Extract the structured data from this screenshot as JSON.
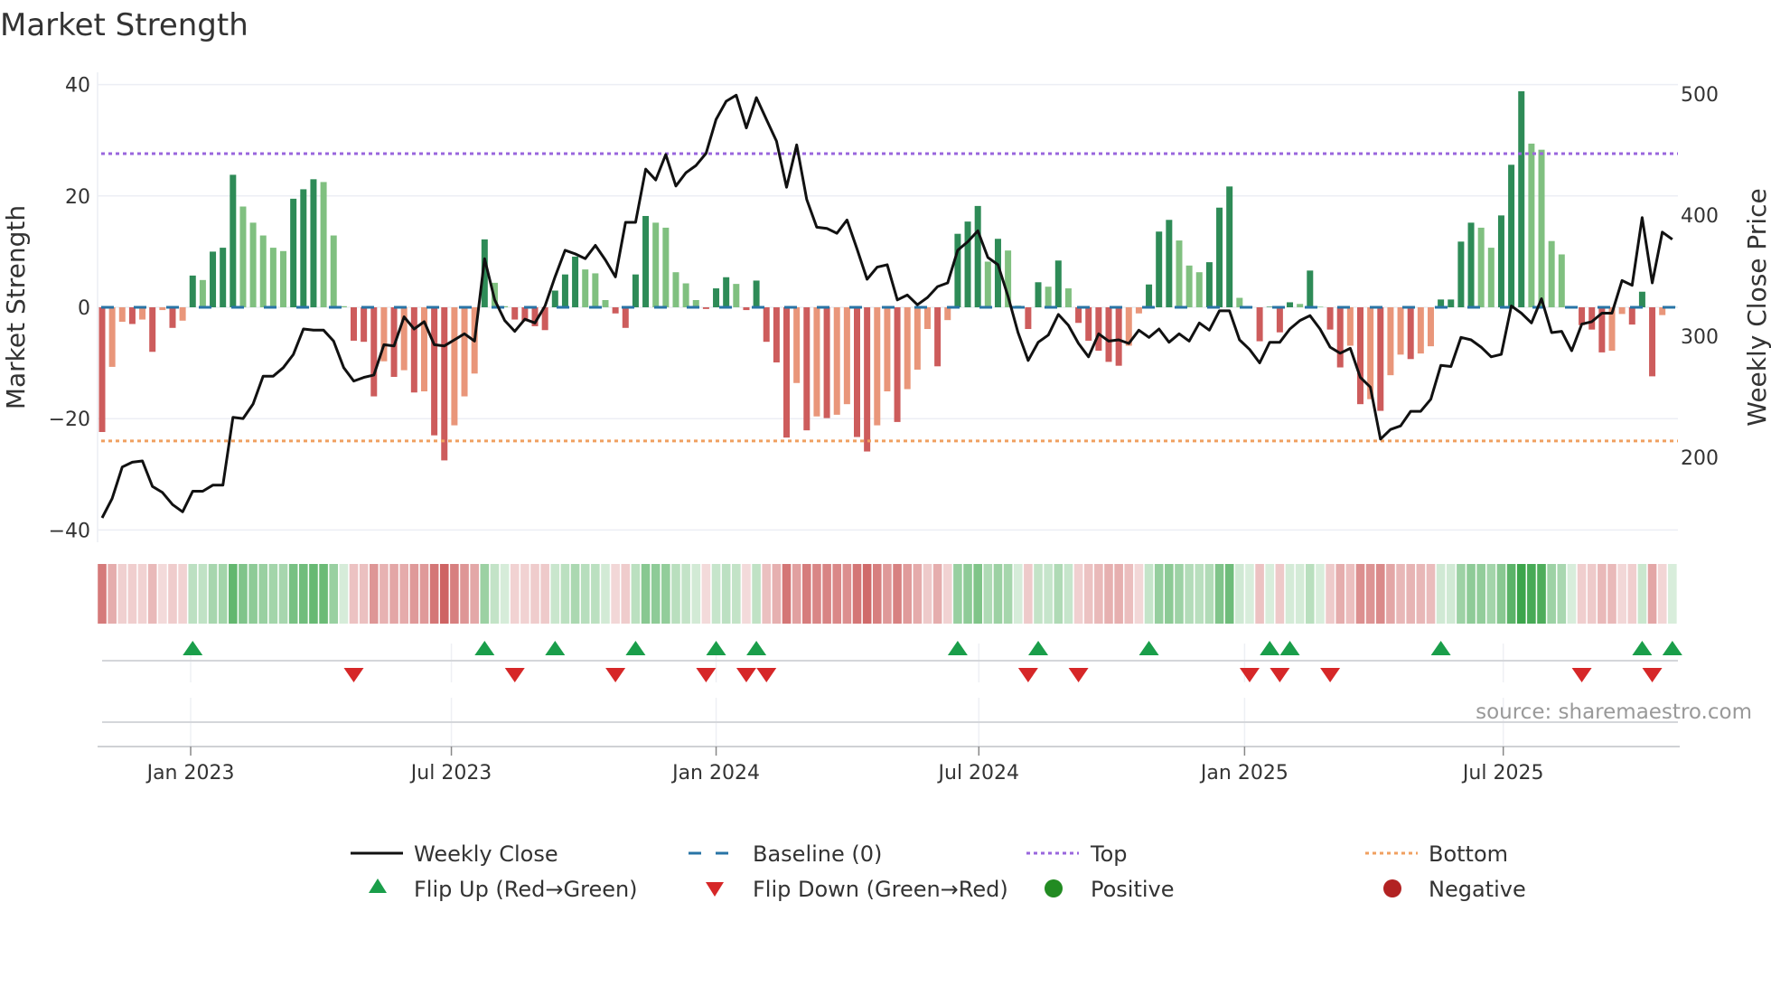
{
  "title": "Market Strength",
  "source": "source: sharemaestro.com",
  "colors": {
    "bar_pos_rising": "#2e8b57",
    "bar_pos_falling": "#80c080",
    "bar_neg_falling": "#cd5c5c",
    "bar_neg_rising": "#e9967a",
    "line": "#111111",
    "baseline": "#2874a6",
    "top": "#9966dd",
    "bottom": "#f0a060",
    "flip_up": "#1a9e4a",
    "flip_down": "#d62728",
    "positive": "#228b22",
    "negative": "#b22222"
  },
  "legend": {
    "weekly_close": "Weekly Close",
    "baseline": "Baseline (0)",
    "top": "Top",
    "bottom": "Bottom",
    "flip_up": "Flip Up (Red→Green)",
    "flip_down": "Flip Down (Green→Red)",
    "positive": "Positive",
    "negative": "Negative"
  },
  "chart_data": {
    "type": "bar",
    "title": "Market Strength",
    "ylabel": "Market Strength",
    "y2label": "Weekly Close Price",
    "ylim": [
      -40,
      40
    ],
    "y2lim": [
      200,
      500
    ],
    "yticks": [
      "40",
      "20",
      "0",
      "−20",
      "−40"
    ],
    "ytick_values": [
      40,
      20,
      0,
      -20,
      -40
    ],
    "y2ticks": [
      "500",
      "400",
      "300",
      "200"
    ],
    "y2tick_values": [
      500,
      400,
      300,
      200
    ],
    "xticks": [
      {
        "label": "Jan 2023",
        "week": 8.8
      },
      {
        "label": "Jul 2023",
        "week": 34.7
      },
      {
        "label": "Jan 2024",
        "week": 61
      },
      {
        "label": "Jul 2024",
        "week": 87.1
      },
      {
        "label": "Jan 2025",
        "week": 113.5
      },
      {
        "label": "Jul 2025",
        "week": 139.2
      }
    ],
    "top_level": 27.6,
    "bottom_level": -24,
    "baseline": 0,
    "strength": [
      -22.4,
      -10.7,
      -2.6,
      -3,
      -2.2,
      -8,
      -0.5,
      -3.7,
      -2.4,
      5.7,
      4.9,
      10,
      10.7,
      23.8,
      18.1,
      15.2,
      12.9,
      10.7,
      10.1,
      19.5,
      21.2,
      23,
      22.5,
      12.9,
      0.2,
      -6,
      -6.2,
      -16,
      -9.7,
      -12.5,
      -11.3,
      -15.3,
      -15.1,
      -23,
      -27.5,
      -21.2,
      -16,
      -11.9,
      12.2,
      4.4,
      0.2,
      -2.2,
      -2.5,
      -3.4,
      -4.1,
      3,
      5.9,
      9.1,
      6.8,
      6.1,
      1.3,
      -1.1,
      -3.7,
      5.9,
      16.4,
      15.2,
      14.3,
      6.3,
      4.3,
      1.3,
      -0.3,
      3.4,
      5.4,
      4.2,
      -0.5,
      4.8,
      -6.2,
      -9.9,
      -23.4,
      -13.6,
      -22.1,
      -19.6,
      -19.9,
      -19.3,
      -17.4,
      -23.3,
      -25.9,
      -21.2,
      -15.1,
      -20.6,
      -14.7,
      -11.2,
      -3.9,
      -10.6,
      -2.3,
      13.2,
      15.4,
      18.2,
      8.2,
      12.3,
      10.2,
      0.3,
      -3.9,
      4.5,
      3.7,
      8.4,
      3.4,
      -2.8,
      -6,
      -7.8,
      -9.8,
      -10.5,
      -6.9,
      -1.1,
      4.1,
      13.6,
      15.7,
      12,
      7.5,
      6.3,
      8.1,
      17.9,
      21.7,
      1.7,
      0.1,
      -6.1,
      0.1,
      -4.5,
      0.9,
      0.6,
      6.6,
      0.1,
      -4,
      -10.8,
      -6.9,
      -17.4,
      -16.5,
      -18.6,
      -12.2,
      -8.5,
      -9.3,
      -8.3,
      -7,
      1.4,
      1.4,
      11.8,
      15.2,
      14.3,
      10.7,
      16.5,
      25.6,
      38.8,
      29.4,
      28.3,
      11.9,
      9.5,
      0.1,
      -3.2,
      -4,
      -8.1,
      -7.8,
      -1.2,
      -3.1,
      2.8,
      -12.4,
      -1.4,
      0.1
    ],
    "weekly_close": [
      150,
      166,
      192,
      196,
      197,
      176,
      171,
      161,
      155,
      172,
      172,
      177,
      177,
      233,
      232,
      244,
      267,
      267,
      274,
      285,
      306,
      305,
      305,
      296,
      274,
      263,
      266,
      268,
      293,
      292,
      316,
      306,
      312,
      293,
      292,
      297,
      302,
      296,
      364,
      330,
      313,
      304,
      314,
      311,
      325,
      349,
      371,
      368,
      364,
      375,
      363,
      349,
      394,
      394,
      438,
      429,
      450,
      424,
      435,
      441,
      451,
      479,
      494,
      499,
      472,
      497,
      479,
      461,
      423,
      458,
      413,
      390,
      389,
      385,
      396,
      372,
      347,
      357,
      359,
      330,
      334,
      326,
      332,
      341,
      344,
      371,
      378,
      387,
      365,
      359,
      333,
      303,
      280,
      295,
      301,
      318,
      309,
      294,
      283,
      302,
      296,
      297,
      294,
      305,
      299,
      306,
      295,
      302,
      296,
      311,
      305,
      321,
      321,
      297,
      289,
      278,
      295,
      295,
      306,
      313,
      317,
      306,
      291,
      286,
      290,
      266,
      258,
      215,
      223,
      226,
      238,
      238,
      248,
      276,
      275,
      299,
      297,
      291,
      283,
      285,
      325,
      319,
      311,
      331,
      303,
      304,
      288,
      310,
      312,
      319,
      319,
      346,
      342,
      398,
      344,
      386,
      380
    ],
    "flip_up_weeks": [
      9,
      38,
      45,
      53,
      61,
      65,
      85,
      93,
      104,
      116,
      118,
      133,
      153,
      156
    ],
    "flip_down_weeks": [
      25,
      41,
      51,
      60,
      64,
      66,
      92,
      97,
      114,
      117,
      122,
      147,
      154
    ]
  }
}
